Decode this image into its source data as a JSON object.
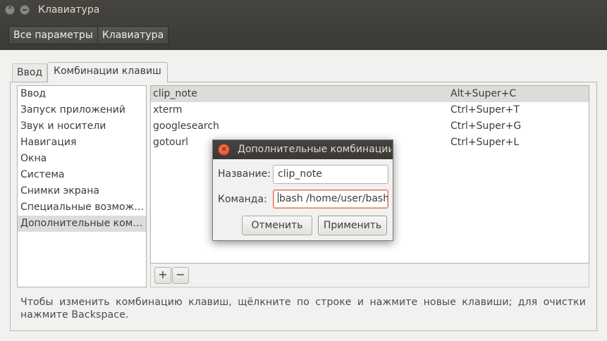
{
  "window": {
    "title": "Клавиатура",
    "breadcrumbs": [
      "Все параметры",
      "Клавиатура"
    ]
  },
  "tabs": [
    {
      "label": "Ввод",
      "active": false
    },
    {
      "label": "Комбинации клавиш",
      "active": true
    }
  ],
  "categories": [
    "Ввод",
    "Запуск приложений",
    "Звук и носители",
    "Навигация",
    "Окна",
    "Система",
    "Снимки экрана",
    "Специальные возмож…",
    "Дополнительные ком…"
  ],
  "selected_category": 8,
  "shortcuts": [
    {
      "name": "clip_note",
      "keys": "Alt+Super+C",
      "selected": true
    },
    {
      "name": "xterm",
      "keys": "Ctrl+Super+T",
      "selected": false
    },
    {
      "name": "googlesearch",
      "keys": "Ctrl+Super+G",
      "selected": false
    },
    {
      "name": "gotourl",
      "keys": "Ctrl+Super+L",
      "selected": false
    }
  ],
  "toolbar": {
    "add_label": "+",
    "remove_label": "−"
  },
  "hint": "Чтобы изменить комбинацию клавиш, щёлкните по строке и нажмите новые клавиши; для очистки нажмите Backspace.",
  "dialog": {
    "title": "Дополнительные комбинации",
    "name_label": "Название:",
    "name_value": "clip_note",
    "command_label": "Команда:",
    "command_value": "bash /home/user/bash",
    "cancel_label": "Отменить",
    "apply_label": "Применить"
  },
  "colors": {
    "titlebar": "#3c3b37",
    "selection": "#dedcd9",
    "close_button": "#df4a26",
    "focus_border": "#e4785b"
  }
}
